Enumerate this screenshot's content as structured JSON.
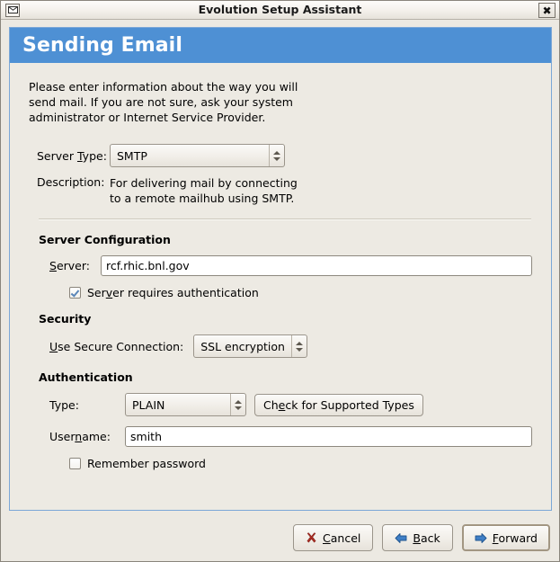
{
  "window": {
    "title": "Evolution Setup Assistant",
    "icon": "envelope-icon",
    "close_label": "✖"
  },
  "assistant": {
    "banner_title": "Sending Email",
    "intro": "Please enter information about the way you will send mail. If you are not sure, ask your system administrator or Internet Service Provider.",
    "server_type": {
      "label_pre": "Server ",
      "label_mnemonic": "T",
      "label_post": "ype:",
      "value": "SMTP"
    },
    "description": {
      "label": "Description:",
      "line1": "For delivering mail by connecting",
      "line2": "to a remote mailhub using SMTP."
    },
    "server_configuration": {
      "heading": "Server Configuration",
      "server_label_pre": "",
      "server_label_mnemonic": "S",
      "server_label_post": "erver:",
      "server_value": "rcf.rhic.bnl.gov",
      "requires_auth_pre": "Ser",
      "requires_auth_mnemonic": "v",
      "requires_auth_post": "er requires authentication",
      "requires_auth_checked": true
    },
    "security": {
      "heading": "Security",
      "secure_label_pre": "",
      "secure_label_mnemonic": "U",
      "secure_label_post": "se Secure Connection:",
      "secure_value": "SSL encryption"
    },
    "authentication": {
      "heading": "Authentication",
      "type_label": "Type:",
      "type_value": "PLAIN",
      "check_button_pre": "Ch",
      "check_button_mnemonic": "e",
      "check_button_post": "ck for Supported Types",
      "username_label_pre": "User",
      "username_label_mnemonic": "n",
      "username_label_post": "ame:",
      "username_value": "smith",
      "remember_label": "Remember password",
      "remember_checked": false
    }
  },
  "actions": {
    "cancel_pre": "",
    "cancel_mnemonic": "C",
    "cancel_post": "ancel",
    "cancel_icon": "cancel-x-icon",
    "back_pre": "",
    "back_mnemonic": "B",
    "back_post": "ack",
    "back_icon": "arrow-left-icon",
    "forward_pre": "",
    "forward_mnemonic": "F",
    "forward_post": "orward",
    "forward_icon": "arrow-right-icon"
  },
  "colors": {
    "banner_blue": "#4e90d4",
    "window_bg": "#ece9e2",
    "frame_border": "#7ba7d7",
    "arrow_blue": "#2f6fbd",
    "cancel_red": "#a82b21"
  }
}
